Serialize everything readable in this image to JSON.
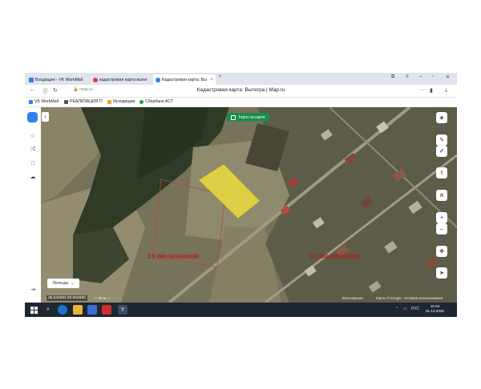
{
  "tabs": [
    {
      "label": "Входящие - VK WorkMail",
      "color": "#2f80ed"
    },
    {
      "label": "кадастровая карта вытег",
      "color": "#e0413a"
    },
    {
      "label": "Кадастровая карта: Вы",
      "color": "#2f80ed",
      "active": true
    }
  ],
  "new_tab": "+",
  "address": {
    "url": "map.ru",
    "page_title": "Кадастровая карта: Вытегра | Map.ru",
    "more": "···"
  },
  "bookmarks": [
    {
      "label": "VK WorkMail",
      "color": "#2f80ed"
    },
    {
      "label": "РЕАЛИЗАЦИЯ П",
      "color": "#555555"
    },
    {
      "label": "Исходящие",
      "color": "#e6a23c"
    },
    {
      "label": "Сбербанк-АСТ",
      "color": "#21a038"
    }
  ],
  "map": {
    "torgi_label": "Торги на карте",
    "legend_label": "Легенда",
    "coords": "35.534682  60.854660",
    "scale": "— 20 м —",
    "beta_label": "Бета-версия",
    "attribution": "Карты © Google · Условия использования",
    "cadastral_labels": [
      "35:00:0000000",
      "35:00:0000000"
    ]
  },
  "taskbar": {
    "lang": "РУС",
    "time": "16:34",
    "date": "01.12.2025"
  },
  "colors": {
    "parcel_fill": "#f3e33b",
    "cad_text": "#b3191f",
    "torgi_bg": "#1e8a4c",
    "accent": "#2f80ed"
  }
}
